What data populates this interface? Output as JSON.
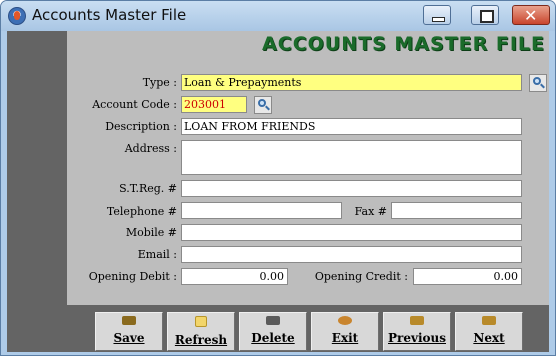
{
  "window": {
    "title": "Accounts Master File"
  },
  "form": {
    "heading": "ACCOUNTS MASTER FILE",
    "type": {
      "label": "Type :",
      "value": "Loan & Prepayments"
    },
    "account_code": {
      "label": "Account Code :",
      "value": "203001"
    },
    "description": {
      "label": "Description :",
      "value": "LOAN FROM FRIENDS"
    },
    "address": {
      "label": "Address :",
      "value": ""
    },
    "streg": {
      "label": "S.T.Reg. #",
      "value": ""
    },
    "telephone": {
      "label": "Telephone #",
      "value": ""
    },
    "fax": {
      "label": "Fax #",
      "value": ""
    },
    "mobile": {
      "label": "Mobile #",
      "value": ""
    },
    "email": {
      "label": "Email :",
      "value": ""
    },
    "opening_debit": {
      "label": "Opening Debit :",
      "value": "0.00"
    },
    "opening_credit": {
      "label": "Opening Credit :",
      "value": "0.00"
    }
  },
  "toolbar": {
    "save": "Save",
    "refresh": "Refresh",
    "delete": "Delete",
    "exit": "Exit",
    "previous": "Previous",
    "next": "Next"
  },
  "colors": {
    "heading": "#1a6b2a",
    "highlight_field": "#ffff80",
    "code_text": "#cc0000",
    "panel": "#bdbdbd",
    "frame": "#646464"
  },
  "icons": {
    "app": "app-icon",
    "lookup": "magnifier-icon",
    "save": "save-icon",
    "refresh": "folder-icon",
    "delete": "delete-icon",
    "exit": "exit-icon",
    "previous": "rewind-icon",
    "next": "fast-forward-icon"
  }
}
